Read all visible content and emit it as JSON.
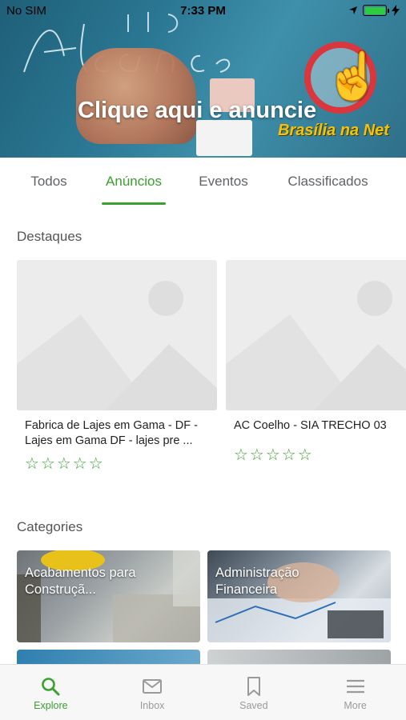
{
  "status_bar": {
    "carrier": "No SIM",
    "time": "7:33 PM"
  },
  "banner": {
    "title": "Clique aqui e anuncie",
    "brand": "Brasília na Net",
    "script_text": "Alcance"
  },
  "tabs": [
    {
      "label": "Todos"
    },
    {
      "label": "Anúncios",
      "active": true
    },
    {
      "label": "Eventos"
    },
    {
      "label": "Classificados"
    }
  ],
  "featured": {
    "title": "Destaques",
    "items": [
      {
        "title": "Fabrica de Lajes em Gama - DF - Lajes em Gama DF - lajes pre ...",
        "rating": 0
      },
      {
        "title": "AC Coelho - SIA TRECHO 03",
        "rating": 0
      }
    ]
  },
  "categories": {
    "title": "Categories",
    "items": [
      {
        "label": "Acabamentos para Construçã..."
      },
      {
        "label": "Administração Financeira"
      }
    ]
  },
  "bottom_nav": [
    {
      "label": "Explore",
      "icon": "search-icon",
      "active": true
    },
    {
      "label": "Inbox",
      "icon": "mail-icon"
    },
    {
      "label": "Saved",
      "icon": "bookmark-icon"
    },
    {
      "label": "More",
      "icon": "menu-icon"
    }
  ],
  "colors": {
    "accent": "#3aa02f",
    "placeholder": "#ececec"
  }
}
